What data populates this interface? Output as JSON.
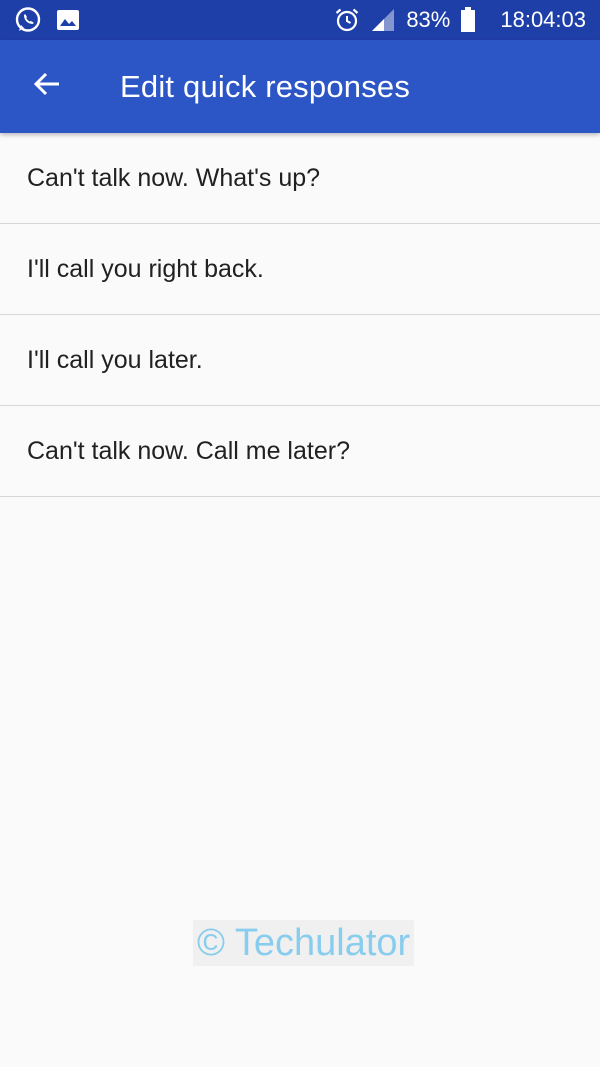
{
  "status_bar": {
    "left_icons": [
      "whatsapp-icon",
      "image-icon"
    ],
    "right_icons": [
      "alarm-icon",
      "signal-icon",
      "battery-icon"
    ],
    "battery": "83%",
    "time": "18:04:03"
  },
  "app_bar": {
    "back_icon": "arrow-back-icon",
    "title": "Edit quick responses"
  },
  "responses": [
    "Can't talk now. What's up?",
    "I'll call you right back.",
    "I'll call you later.",
    "Can't talk now. Call me later?"
  ],
  "watermark": "© Techulator",
  "colors": {
    "status_bar": "#1f3fa8",
    "app_bar": "#2c56c6",
    "background": "#fafafa",
    "divider": "#d7d7d7",
    "text": "#212121",
    "watermark": "#89cdee"
  }
}
